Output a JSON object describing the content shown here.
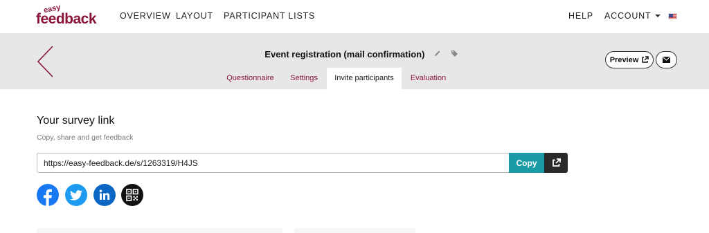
{
  "brand": {
    "top": "easy",
    "bottom": "feedback",
    "color": "#8a1538"
  },
  "nav": {
    "left": [
      "OVERVIEW",
      "LAYOUT",
      "PARTICIPANT LISTS"
    ],
    "help": "HELP",
    "account": "ACCOUNT",
    "language_icon": "us-flag-icon"
  },
  "header": {
    "survey_title": "Event registration (mail confirmation)",
    "preview_label": "Preview",
    "tabs": [
      {
        "label": "Questionnaire",
        "active": false
      },
      {
        "label": "Settings",
        "active": false
      },
      {
        "label": "Invite participants",
        "active": true
      },
      {
        "label": "Evaluation",
        "active": false
      }
    ]
  },
  "content": {
    "title": "Your survey link",
    "subtitle": "Copy, share and get feedback",
    "url": "https://easy-feedback.de/s/1263319/H4JS",
    "copy_label": "Copy",
    "share_icons": [
      "facebook-icon",
      "twitter-icon",
      "linkedin-icon",
      "qr-code-icon"
    ]
  },
  "colors": {
    "accent": "#8a1538",
    "copy": "#1a9ba5",
    "facebook": "#1877f2",
    "twitter": "#1d9bf0",
    "linkedin": "#0a66c2",
    "band": "#e7e7e7"
  }
}
